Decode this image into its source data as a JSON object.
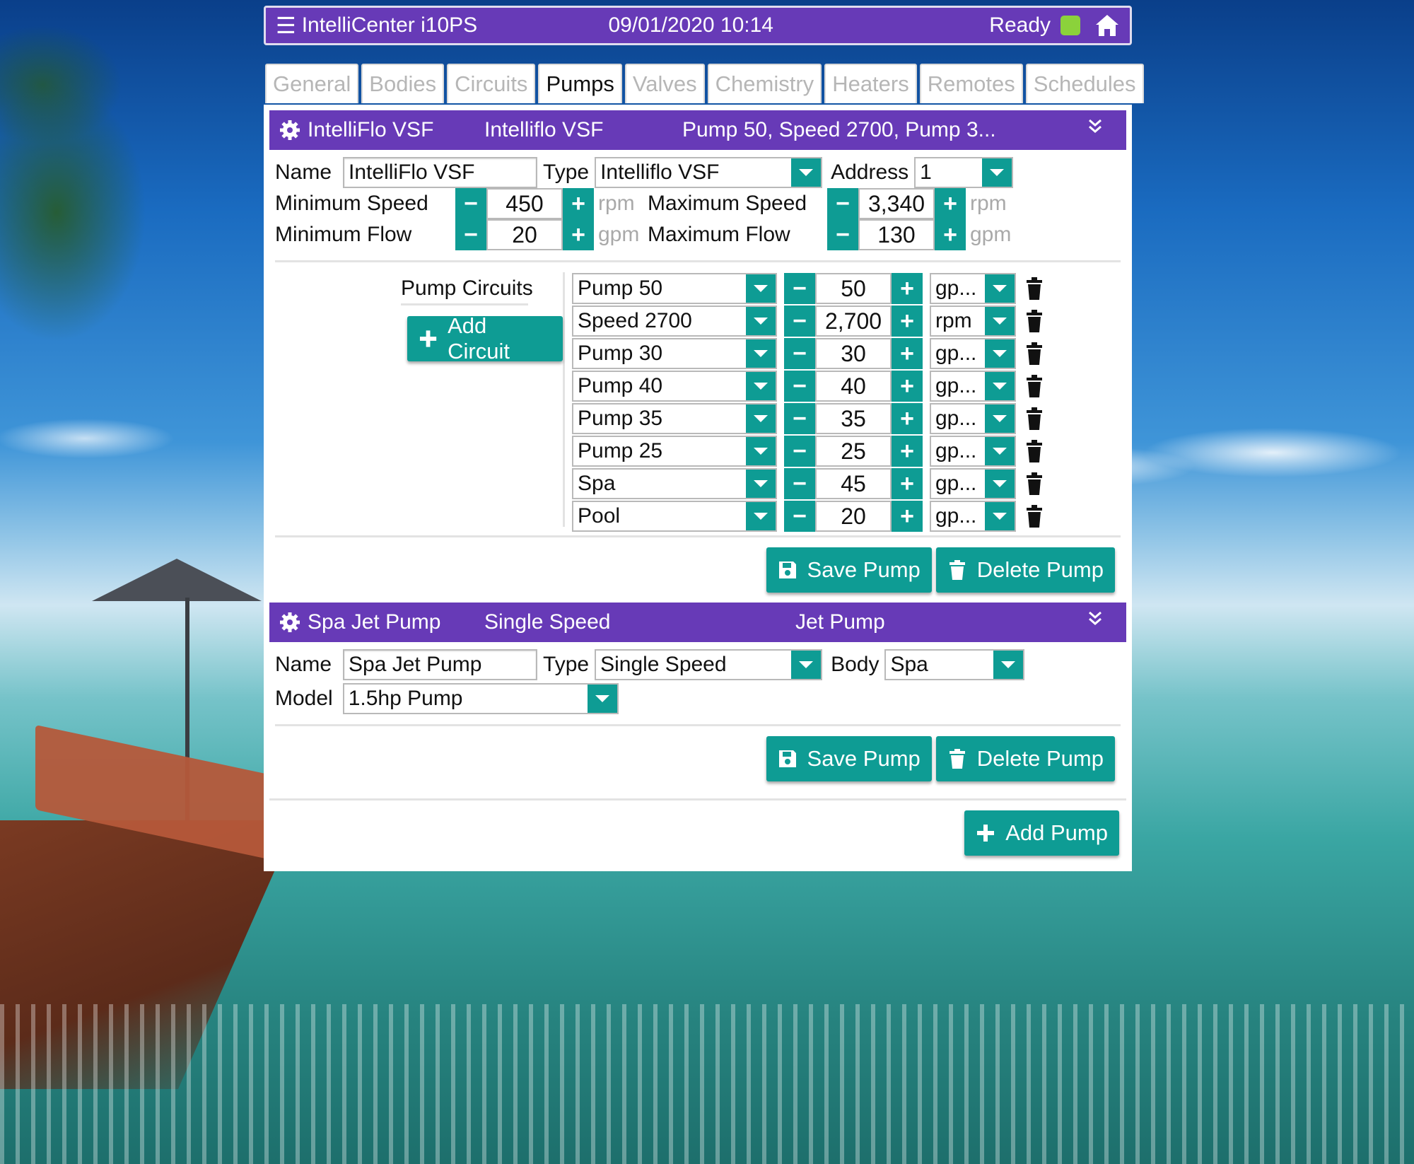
{
  "app": {
    "title": "IntelliCenter i10PS",
    "datetime": "09/01/2020 10:14",
    "status": "Ready"
  },
  "tabs": [
    {
      "label": "General",
      "active": false
    },
    {
      "label": "Bodies",
      "active": false
    },
    {
      "label": "Circuits",
      "active": false
    },
    {
      "label": "Pumps",
      "active": true
    },
    {
      "label": "Valves",
      "active": false
    },
    {
      "label": "Chemistry",
      "active": false
    },
    {
      "label": "Heaters",
      "active": false
    },
    {
      "label": "Remotes",
      "active": false
    },
    {
      "label": "Schedules",
      "active": false
    }
  ],
  "pump1": {
    "header": {
      "name": "IntelliFlo VSF",
      "type": "Intelliflo VSF",
      "summary": "Pump 50, Speed 2700, Pump 3..."
    },
    "name_label": "Name",
    "name_value": "IntelliFlo VSF",
    "type_label": "Type",
    "type_value": "Intelliflo VSF",
    "address_label": "Address",
    "address_value": "1",
    "min_speed_label": "Minimum Speed",
    "min_speed": "450",
    "min_speed_unit": "rpm",
    "max_speed_label": "Maximum Speed",
    "max_speed": "3,340",
    "max_speed_unit": "rpm",
    "min_flow_label": "Minimum Flow",
    "min_flow": "20",
    "min_flow_unit": "gpm",
    "max_flow_label": "Maximum Flow",
    "max_flow": "130",
    "max_flow_unit": "gpm",
    "circuits_label": "Pump Circuits",
    "add_circuit": "Add Circuit",
    "circuits": [
      {
        "circuit": "Pump 50",
        "value": "50",
        "unit": "gp..."
      },
      {
        "circuit": "Speed 2700",
        "value": "2,700",
        "unit": "rpm"
      },
      {
        "circuit": "Pump 30",
        "value": "30",
        "unit": "gp..."
      },
      {
        "circuit": "Pump 40",
        "value": "40",
        "unit": "gp..."
      },
      {
        "circuit": "Pump 35",
        "value": "35",
        "unit": "gp..."
      },
      {
        "circuit": "Pump 25",
        "value": "25",
        "unit": "gp..."
      },
      {
        "circuit": "Spa",
        "value": "45",
        "unit": "gp..."
      },
      {
        "circuit": "Pool",
        "value": "20",
        "unit": "gp..."
      }
    ],
    "save": "Save Pump",
    "delete": "Delete Pump"
  },
  "pump2": {
    "header": {
      "name": "Spa Jet Pump",
      "type": "Single Speed",
      "summary": "Jet Pump"
    },
    "name_label": "Name",
    "name_value": "Spa Jet Pump",
    "type_label": "Type",
    "type_value": "Single Speed",
    "body_label": "Body",
    "body_value": "Spa",
    "model_label": "Model",
    "model_value": "1.5hp Pump",
    "save": "Save Pump",
    "delete": "Delete Pump"
  },
  "add_pump": "Add Pump",
  "stepper": {
    "minus": "−",
    "plus": "+"
  },
  "icons": {
    "menu": "☰",
    "expand": "⌄⌄"
  },
  "colors": {
    "header": "#673ab7",
    "accent": "#0e9c94",
    "led": "#8bd23b"
  }
}
